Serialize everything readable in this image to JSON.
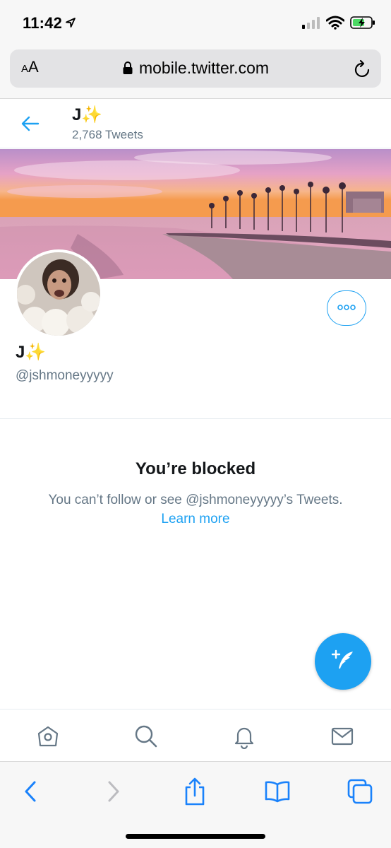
{
  "status_bar": {
    "time": "11:42",
    "icons": [
      "location-arrow-icon",
      "cellular-signal-icon",
      "wifi-icon",
      "battery-charging-icon"
    ]
  },
  "browser": {
    "text_size_label_small": "A",
    "text_size_label_large": "A",
    "url": "mobile.twitter.com",
    "icons": [
      "lock-icon",
      "reload-icon"
    ]
  },
  "header": {
    "name": "J✨",
    "tweet_count": "2,768 Tweets"
  },
  "profile": {
    "name": "J✨",
    "handle": "@jshmoneyyyyy"
  },
  "blocked": {
    "title": "You’re blocked",
    "message": "You can’t follow or see @jshmoneyyyyy’s Tweets.",
    "link": "Learn more"
  },
  "colors": {
    "accent": "#1da1f2",
    "secondary_text": "#657786",
    "primary_text": "#14171a"
  },
  "tab_bar": {
    "tabs": [
      "home-icon",
      "search-icon",
      "notifications-bell-icon",
      "messages-envelope-icon"
    ]
  },
  "safari_toolbar": {
    "buttons": [
      "back-icon",
      "forward-icon",
      "share-icon",
      "bookmarks-icon",
      "tabs-icon"
    ]
  }
}
